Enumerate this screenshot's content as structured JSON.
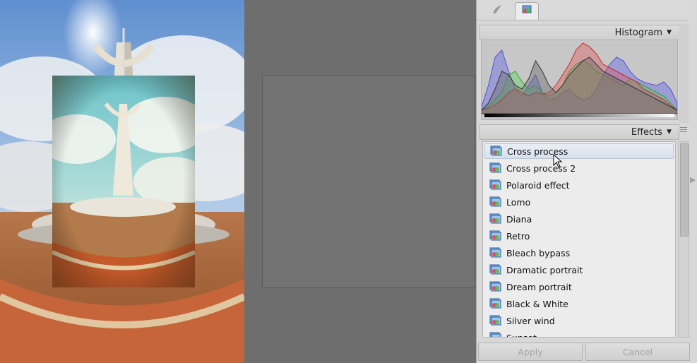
{
  "histogram": {
    "title": "Histogram",
    "colors": {
      "red": "#e14848",
      "green": "#4dd34d",
      "blue": "#6a6ae8",
      "gray": "#5a5a5a"
    }
  },
  "effects": {
    "title": "Effects",
    "items": [
      {
        "label": "Cross process"
      },
      {
        "label": "Cross process 2"
      },
      {
        "label": "Polaroid effect"
      },
      {
        "label": "Lomo"
      },
      {
        "label": "Diana"
      },
      {
        "label": "Retro"
      },
      {
        "label": "Bleach bypass"
      },
      {
        "label": "Dramatic portrait"
      },
      {
        "label": "Dream portrait"
      },
      {
        "label": "Black & White"
      },
      {
        "label": "Silver wind"
      },
      {
        "label": "Sunset"
      }
    ],
    "selected_index": 0
  },
  "buttons": {
    "apply": "Apply",
    "cancel": "Cancel"
  },
  "tabs": [
    {
      "icon": "brush-icon",
      "active": false
    },
    {
      "icon": "effects-icon",
      "active": true
    }
  ]
}
